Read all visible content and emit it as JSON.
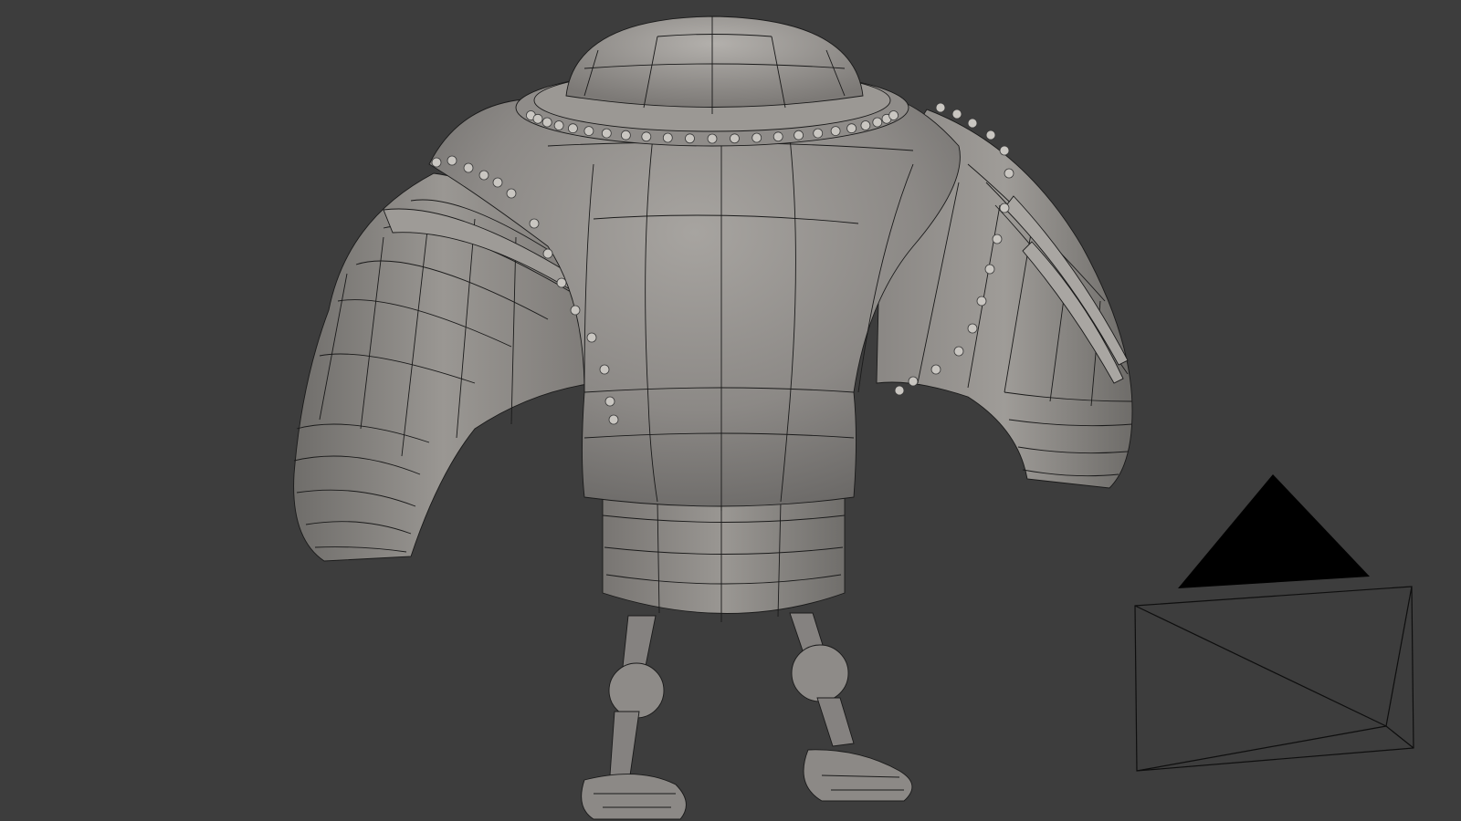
{
  "viewport": {
    "background": "#3d3d3d",
    "mesh_fill": "#8d8a87",
    "mesh_shadow": "#6b6967",
    "mesh_highlight": "#a8a5a1",
    "wire_color": "#1a1a1a",
    "rivet_color": "#c9c6c1",
    "camera_wire": "#0e0e0e"
  },
  "scene": {
    "object": "robot-mesh",
    "camera": "camera-object"
  }
}
